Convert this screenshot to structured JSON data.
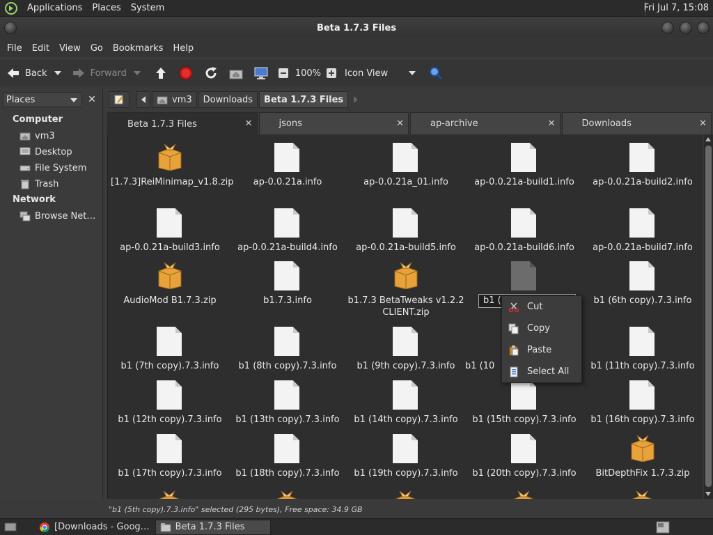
{
  "top_panel": {
    "menus": [
      "Applications",
      "Places",
      "System"
    ],
    "clock": "Fri Jul  7, 15:08"
  },
  "window": {
    "title": "Beta 1.7.3 Files"
  },
  "menubar": [
    "File",
    "Edit",
    "View",
    "Go",
    "Bookmarks",
    "Help"
  ],
  "toolbar": {
    "back": "Back",
    "forward": "Forward",
    "zoom": "100%",
    "view_mode": "Icon View"
  },
  "sidebar": {
    "combo": "Places",
    "computer_header": "Computer",
    "computer_items": [
      "vm3",
      "Desktop",
      "File System",
      "Trash"
    ],
    "network_header": "Network",
    "network_items": [
      "Browse Net…"
    ]
  },
  "breadcrumbs": [
    "vm3",
    "Downloads",
    "Beta 1.7.3 Files"
  ],
  "tabs": [
    "Beta 1.7.3 Files",
    "jsons",
    "ap-archive",
    "Downloads"
  ],
  "files": [
    {
      "name": "[1.7.3]ReiMinimap_v1.8.zip",
      "type": "zip"
    },
    {
      "name": "ap-0.0.21a.info",
      "type": "doc"
    },
    {
      "name": "ap-0.0.21a_01.info",
      "type": "doc"
    },
    {
      "name": "ap-0.0.21a-build1.info",
      "type": "doc"
    },
    {
      "name": "ap-0.0.21a-build2.info",
      "type": "doc"
    },
    {
      "name": "ap-0.0.21a-build3.info",
      "type": "doc"
    },
    {
      "name": "ap-0.0.21a-build4.info",
      "type": "doc"
    },
    {
      "name": "ap-0.0.21a-build5.info",
      "type": "doc"
    },
    {
      "name": "ap-0.0.21a-build6.info",
      "type": "doc"
    },
    {
      "name": "ap-0.0.21a-build7.info",
      "type": "doc"
    },
    {
      "name": "AudioMod B1.7.3.zip",
      "type": "zip"
    },
    {
      "name": "b1.7.3.info",
      "type": "doc"
    },
    {
      "name": "b1.7.3 BetaTweaks v1.2.2 CLIENT.zip",
      "type": "zip"
    },
    {
      "name": "",
      "type": "doc-selected"
    },
    {
      "name": "b1 (6th copy).7.3.info",
      "type": "doc"
    },
    {
      "name": "b1 (7th copy).7.3.info",
      "type": "doc"
    },
    {
      "name": "b1 (8th copy).7.3.info",
      "type": "doc"
    },
    {
      "name": "b1 (9th copy).7.3.info",
      "type": "doc"
    },
    {
      "name": "b1 (10",
      "type": "doc-hidden"
    },
    {
      "name": "b1 (11th copy).7.3.info",
      "type": "doc"
    },
    {
      "name": "b1 (12th copy).7.3.info",
      "type": "doc"
    },
    {
      "name": "b1 (13th copy).7.3.info",
      "type": "doc"
    },
    {
      "name": "b1 (14th copy).7.3.info",
      "type": "doc"
    },
    {
      "name": "b1 (15th copy).7.3.info",
      "type": "doc"
    },
    {
      "name": "b1 (16th copy).7.3.info",
      "type": "doc"
    },
    {
      "name": "b1 (17th copy).7.3.info",
      "type": "doc"
    },
    {
      "name": "b1 (18th copy).7.3.info",
      "type": "doc"
    },
    {
      "name": "b1 (19th copy).7.3.info",
      "type": "doc"
    },
    {
      "name": "b1 (20th copy).7.3.info",
      "type": "doc"
    },
    {
      "name": "BitDepthFix 1.7.3.zip",
      "type": "zip"
    }
  ],
  "rename_text": "b1 (5",
  "context_menu": [
    "Cut",
    "Copy",
    "Paste",
    "Select All"
  ],
  "status": "\"b1 (5th copy).7.3.info\" selected (295 bytes), Free space: 34.9 GB",
  "taskbar": {
    "items": [
      "[Downloads - Goog…",
      "Beta 1.7.3 Files"
    ]
  },
  "colors": {
    "accent": "#f2a93b",
    "background": "#2e2e2e",
    "stop_red": "#d22"
  }
}
